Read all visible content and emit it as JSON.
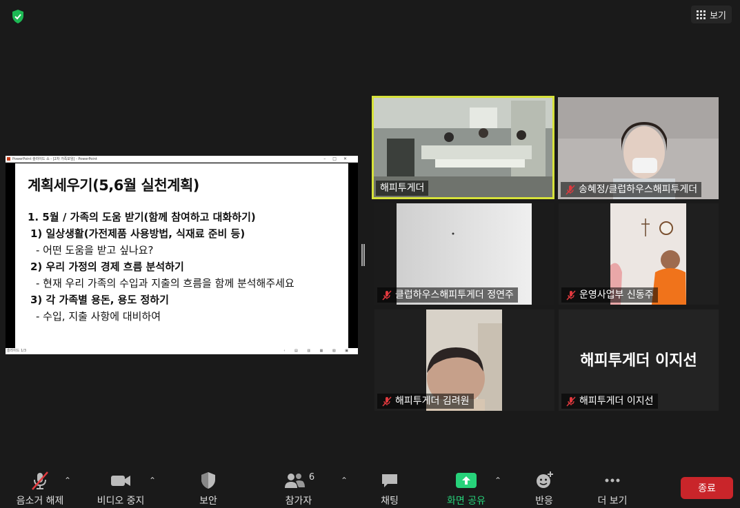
{
  "topbar": {
    "view_label": "보기"
  },
  "share": {
    "titlebar": "PowerPoint 슬라이드 쇼 - [2차 가족모임] - PowerPoint",
    "status": "슬라이드 1/3",
    "slide": {
      "title": "계획세우기(5,6월 실천계획)",
      "lines": [
        "1.   5월 / 가족의 도움 받기(함께 참여하고 대화하기)",
        "1) 일상생활(가전제품 사용방법, 식재료 준비 등)",
        "- 어떤 도움을 받고 싶나요?",
        "2) 우리 가정의 경제 흐름 분석하기",
        "- 현재 우리 가족의 수입과 지출의 흐름을 함께 분석해주세요",
        "3) 각 가족별 용돈, 용도 정하기",
        "- 수입, 지출 사항에 대비하여"
      ]
    }
  },
  "participants": [
    {
      "name": "해피투게더",
      "muted": false,
      "active": true
    },
    {
      "name": "송혜정/클럽하우스해피투게더",
      "muted": true,
      "active": false
    },
    {
      "name": "클럽하우스해피투게더 정연주",
      "muted": true,
      "active": false
    },
    {
      "name": "운영사업부 신동주",
      "muted": true,
      "active": false
    },
    {
      "name": "해피투게더 김려원",
      "muted": true,
      "active": false
    },
    {
      "name": "해피투게더 이지선",
      "muted": true,
      "active": false,
      "big_label": "해피투게더 이지선"
    }
  ],
  "toolbar": {
    "unmute": "음소거 해제",
    "video": "비디오 중지",
    "security": "보안",
    "participants": "참가자",
    "participants_count": "6",
    "chat": "채팅",
    "share": "화면 공유",
    "reactions": "반응",
    "more": "더 보기",
    "end": "종료"
  },
  "colors": {
    "active_speaker": "#d7e23a",
    "share_green": "#27d27a",
    "end_red": "#c9252a",
    "muted_red": "#e0393e"
  }
}
